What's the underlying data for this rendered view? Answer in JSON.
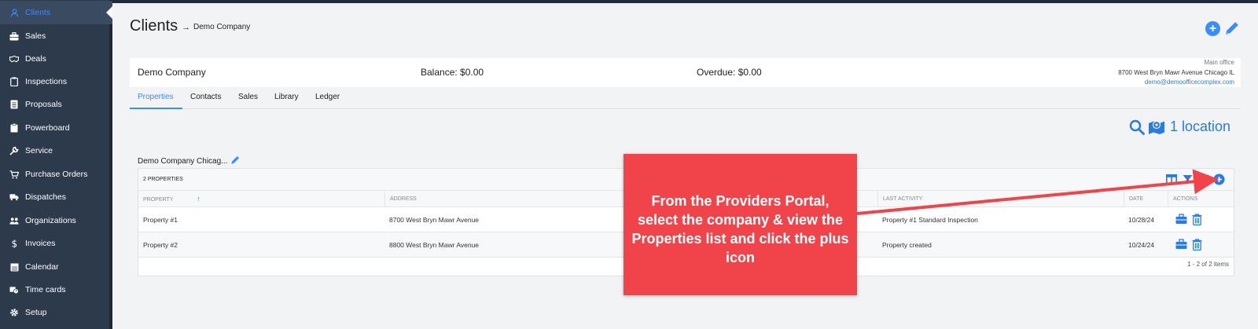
{
  "sidebar": {
    "items": [
      {
        "label": "Clients",
        "icon": "person-icon"
      },
      {
        "label": "Sales",
        "icon": "briefcase-icon"
      },
      {
        "label": "Deals",
        "icon": "handshake-icon"
      },
      {
        "label": "Inspections",
        "icon": "clipboard-icon"
      },
      {
        "label": "Proposals",
        "icon": "document-icon"
      },
      {
        "label": "Powerboard",
        "icon": "clipboard-icon"
      },
      {
        "label": "Service",
        "icon": "wrench-icon"
      },
      {
        "label": "Purchase Orders",
        "icon": "cart-icon"
      },
      {
        "label": "Dispatches",
        "icon": "truck-icon"
      },
      {
        "label": "Organizations",
        "icon": "people-icon"
      },
      {
        "label": "Invoices",
        "icon": "dollar-icon"
      },
      {
        "label": "Calendar",
        "icon": "calendar-icon"
      },
      {
        "label": "Time cards",
        "icon": "clock-card-icon"
      },
      {
        "label": "Setup",
        "icon": "gear-icon"
      }
    ]
  },
  "header": {
    "title": "Clients",
    "crumb_arrow": "→",
    "breadcrumb": "Demo Company"
  },
  "company": {
    "name": "Demo Company",
    "balance": "Balance: $0.00",
    "overdue": "Overdue: $0.00",
    "office_label": "Main office",
    "address": "8700 West Bryn Mawr Avenue Chicago IL",
    "email": "demo@demoofficecomplex.com"
  },
  "tabs": [
    "Properties",
    "Contacts",
    "Sales",
    "Library",
    "Ledger"
  ],
  "locations": {
    "count_text": "1 location"
  },
  "group": {
    "title": "Demo Company Chicag...",
    "count_text": "2 PROPERTIES",
    "columns": [
      "PROPERTY",
      "ADDRESS",
      "LAST ACTIVITY",
      "DATE",
      "ACTIONS"
    ],
    "sort_glyph": "↑",
    "rows": [
      {
        "property": "Property #1",
        "address": "8700 West Bryn Mawr Avenue",
        "last_activity": "Property #1 Standard Inspection",
        "date": "10/28/24"
      },
      {
        "property": "Property #2",
        "address": "8800 West Bryn Mawr Avenue",
        "last_activity": "Property created",
        "date": "10/24/24"
      }
    ],
    "pager": "1 - 2 of 2 items"
  },
  "callout": {
    "text": "From the Providers Portal, select the company & view the Properties list and click the plus icon"
  },
  "colors": {
    "accent": "#3a8dff",
    "sidebar": "#2c3a4c",
    "callout": "#f1444a"
  }
}
